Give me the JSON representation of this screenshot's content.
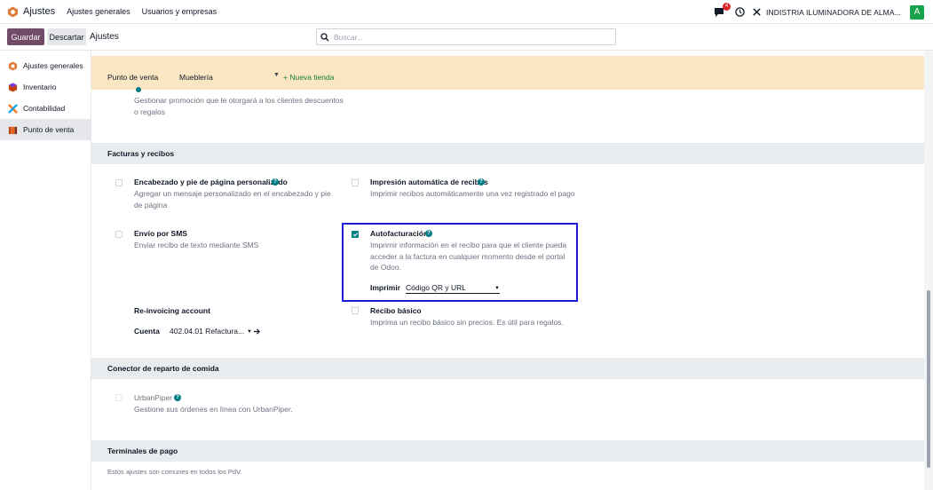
{
  "topbar": {
    "app_name": "Ajustes",
    "menu": [
      "Ajustes generales",
      "Usuarios y empresas"
    ],
    "notification_count": "4",
    "company": "INDISTRIA ILUMINADORA DE ALMA...",
    "avatar_letter": "A"
  },
  "control": {
    "save_label": "Guardar",
    "discard_label": "Descartar",
    "title": "Ajustes",
    "search_placeholder": "Buscar..."
  },
  "sidebar": {
    "items": [
      {
        "label": "Ajustes generales",
        "icon": "odoo-icon"
      },
      {
        "label": "Inventario",
        "icon": "inventory-icon"
      },
      {
        "label": "Contabilidad",
        "icon": "accounting-icon"
      },
      {
        "label": "Punto de venta",
        "icon": "pos-icon",
        "active": true
      }
    ]
  },
  "header": {
    "pos_label": "Punto de venta",
    "shop": "Mueblería",
    "new_shop": "+ Nueva tienda"
  },
  "top_partial": {
    "desc": "Gestionar promoción que le otorgará a los clientes descuentos o regalos"
  },
  "sections": {
    "invoices": "Facturas y recibos",
    "food": "Conector de reparto de comida",
    "terminals": "Terminales de pago"
  },
  "settings": {
    "custom_header": {
      "title": "Encabezado y pie de página personalizado",
      "desc": "Agregar un mensaje personalizado en el encabezado y pie de página",
      "checked": false
    },
    "auto_print": {
      "title": "Impresión automática de recibos",
      "desc": "Imprimir recibos automáticamente una vez registrado el pago",
      "checked": false
    },
    "sms": {
      "title": "Envío por SMS",
      "desc": "Enviar recibo de texto mediante SMS",
      "checked": false
    },
    "self_invoicing": {
      "title": "Autofacturación",
      "desc": "Imprimir información en el recibo para que el cliente pueda acceder a la factura en cualquier momento desde el portal de Odoo.",
      "checked": true,
      "print_label": "Imprimir",
      "print_value": "Código QR y URL"
    },
    "reinvoicing": {
      "title": "Re-invoicing account",
      "account_label": "Cuenta",
      "account_value": "402.04.01 Refactura..."
    },
    "basic_receipt": {
      "title": "Recibo básico",
      "desc": "Imprima un recibo básico sin precios. Es útil para regalos.",
      "checked": false
    },
    "urbanpiper": {
      "title": "UrbanPiper",
      "desc": "Gestione sus órdenes en línea con UrbanPiper.",
      "checked": false
    }
  },
  "terminals_desc": "Estos ajustes son comunes en todos los PdV.",
  "colors": {
    "brand": "#714B67",
    "accent": "#017e84",
    "header_bg": "#fae6c3",
    "highlight": "#1d1dd6"
  }
}
